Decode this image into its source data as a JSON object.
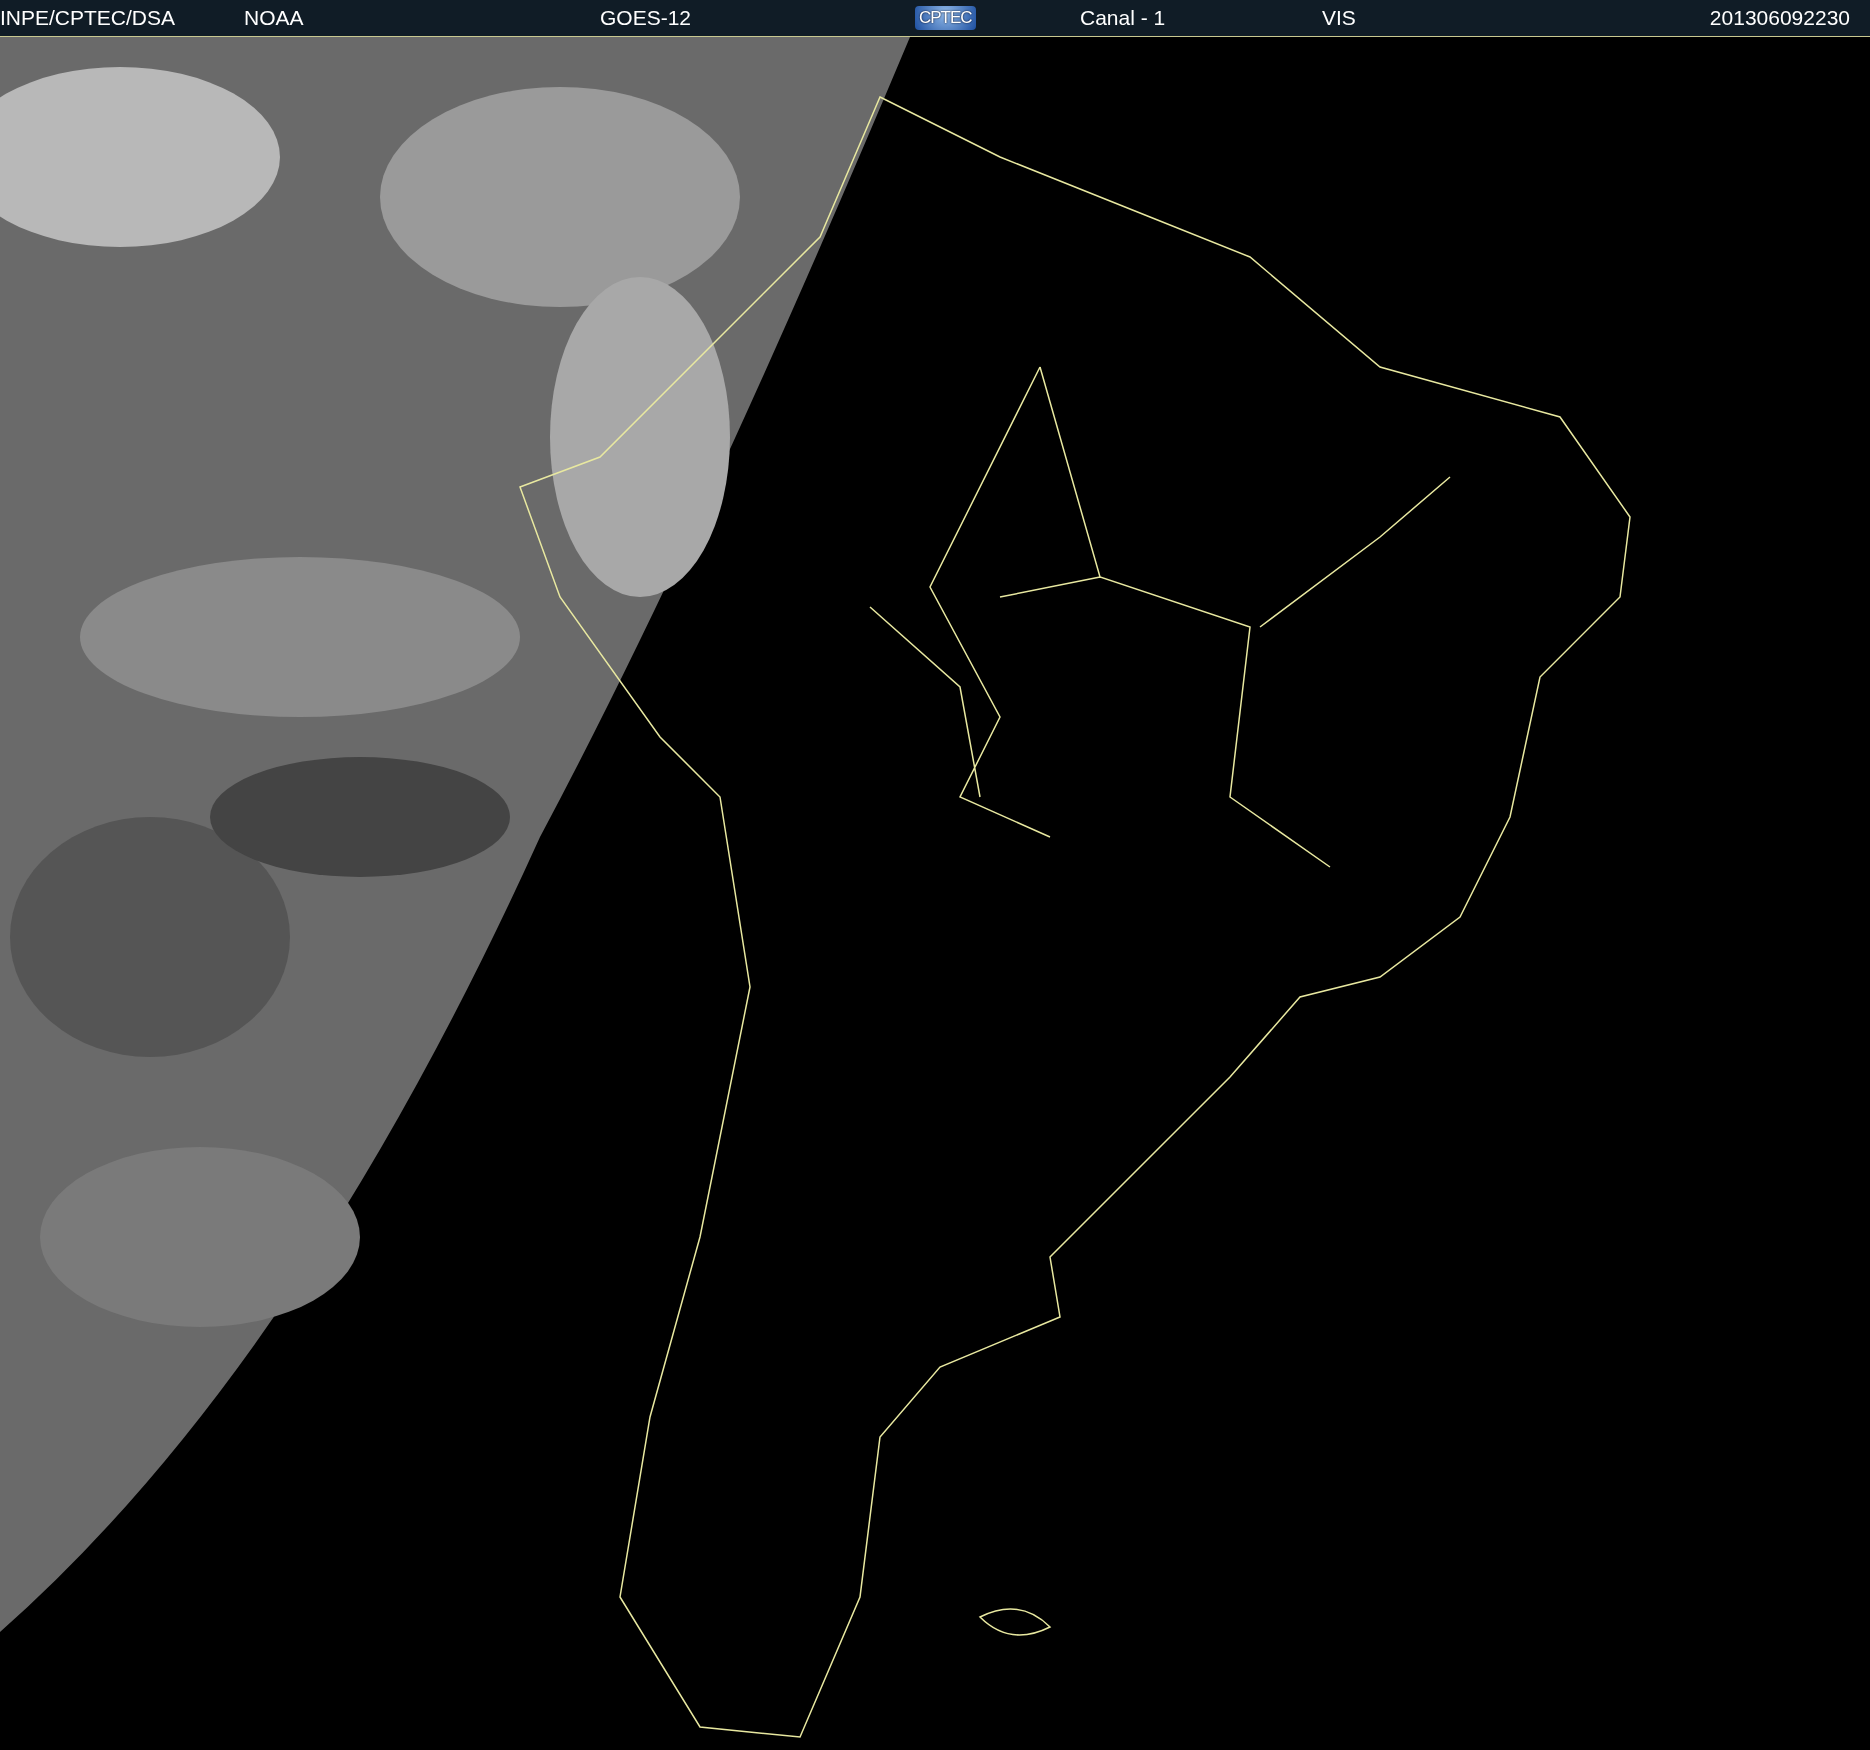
{
  "header": {
    "items": [
      {
        "kind": "text",
        "text": "INPE/CPTEC/DSA"
      },
      {
        "kind": "text",
        "text": "NOAA"
      },
      {
        "kind": "text",
        "text": "GOES-12"
      },
      {
        "kind": "logo",
        "text": "CPTEC"
      },
      {
        "kind": "text",
        "text": "Canal - 1"
      },
      {
        "kind": "text",
        "text": "VIS"
      },
      {
        "kind": "text",
        "text": "201306092230"
      }
    ]
  }
}
